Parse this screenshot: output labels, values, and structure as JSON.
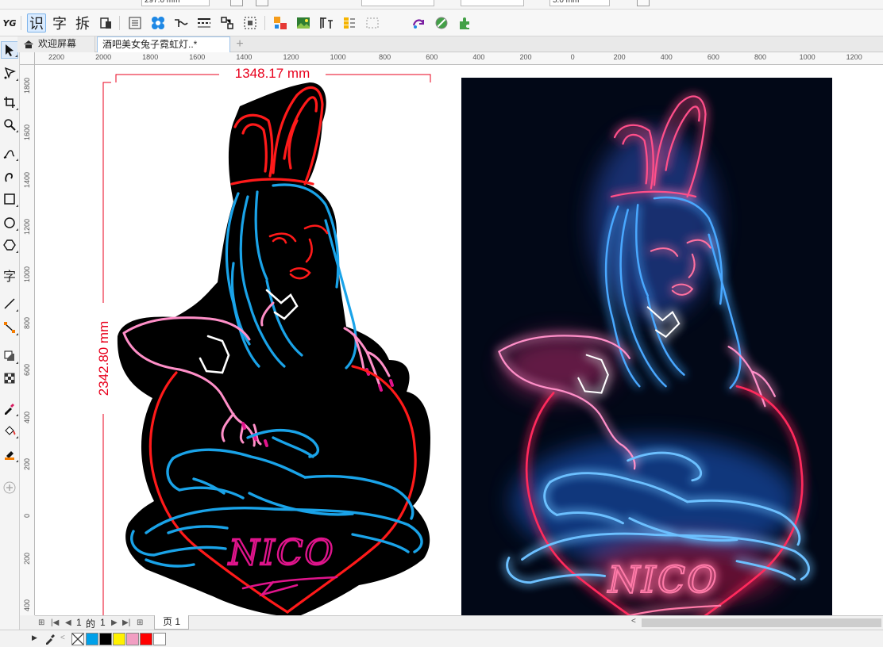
{
  "app": {
    "brand_glyph": "YG"
  },
  "property_bar": {
    "size_value": "297.0 mm",
    "nudge_value": "5.0 mm"
  },
  "toolbar": {
    "btn_ocr": "识",
    "btn_text": "字",
    "btn_split": "拆"
  },
  "tabs": [
    {
      "label": "欢迎屏幕"
    },
    {
      "label": "酒吧美女兔子霓虹灯..*"
    }
  ],
  "tab_add_label": "+",
  "toolbox": {
    "text_tool_label": "字"
  },
  "rulers": {
    "horizontal": [
      "2200",
      "2000",
      "1800",
      "1600",
      "1400",
      "1200",
      "1000",
      "800",
      "600",
      "400",
      "200",
      "0",
      "200",
      "400",
      "600",
      "800",
      "1000",
      "1200"
    ],
    "vertical": [
      "1800",
      "1600",
      "1400",
      "1200",
      "1000",
      "800",
      "600",
      "400",
      "200",
      "0",
      "200",
      "400"
    ]
  },
  "dimensions": {
    "width_label": "1348.17 mm",
    "height_label": "2342.80 mm",
    "dimension_color": "#e8001c"
  },
  "artwork": {
    "sign_text": "NICO",
    "colors": {
      "outline_blue": "#1aa3e8",
      "outline_red": "#ff1a1a",
      "outline_pink": "#ff8fc8",
      "outline_magenta": "#e0148c",
      "preview_bg": "#020817",
      "preview_blue": "#4aa8ff",
      "preview_pink": "#ff4f8a"
    }
  },
  "page_nav": {
    "current": "1",
    "of_label": "的",
    "total": "1",
    "page_tab": "页 1"
  },
  "palette": {
    "colors": [
      "#00a0e9",
      "#000000",
      "#fff100",
      "#f19ec2",
      "#ff0000",
      "#ffffff"
    ]
  }
}
